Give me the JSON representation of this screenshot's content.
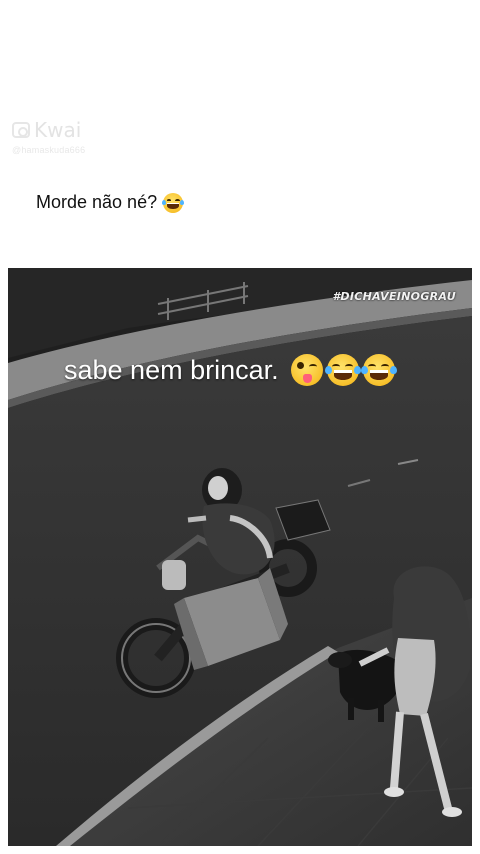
{
  "watermark": {
    "logo_text": "Kwai",
    "handle": "@hamaskuda666"
  },
  "post": {
    "caption": "Morde não né?",
    "caption_emoji": "face-with-tears-of-joy"
  },
  "video": {
    "hashtag": "#DICHAVEINOGRAU",
    "overlay_text": "sabe nem brincar.",
    "overlay_emojis": [
      "winking-face-with-tongue",
      "face-with-tears-of-joy",
      "face-with-tears-of-joy"
    ]
  },
  "colors": {
    "background": "#ffffff",
    "caption_text": "#111111",
    "video_overlay_text": "#ffffff"
  }
}
